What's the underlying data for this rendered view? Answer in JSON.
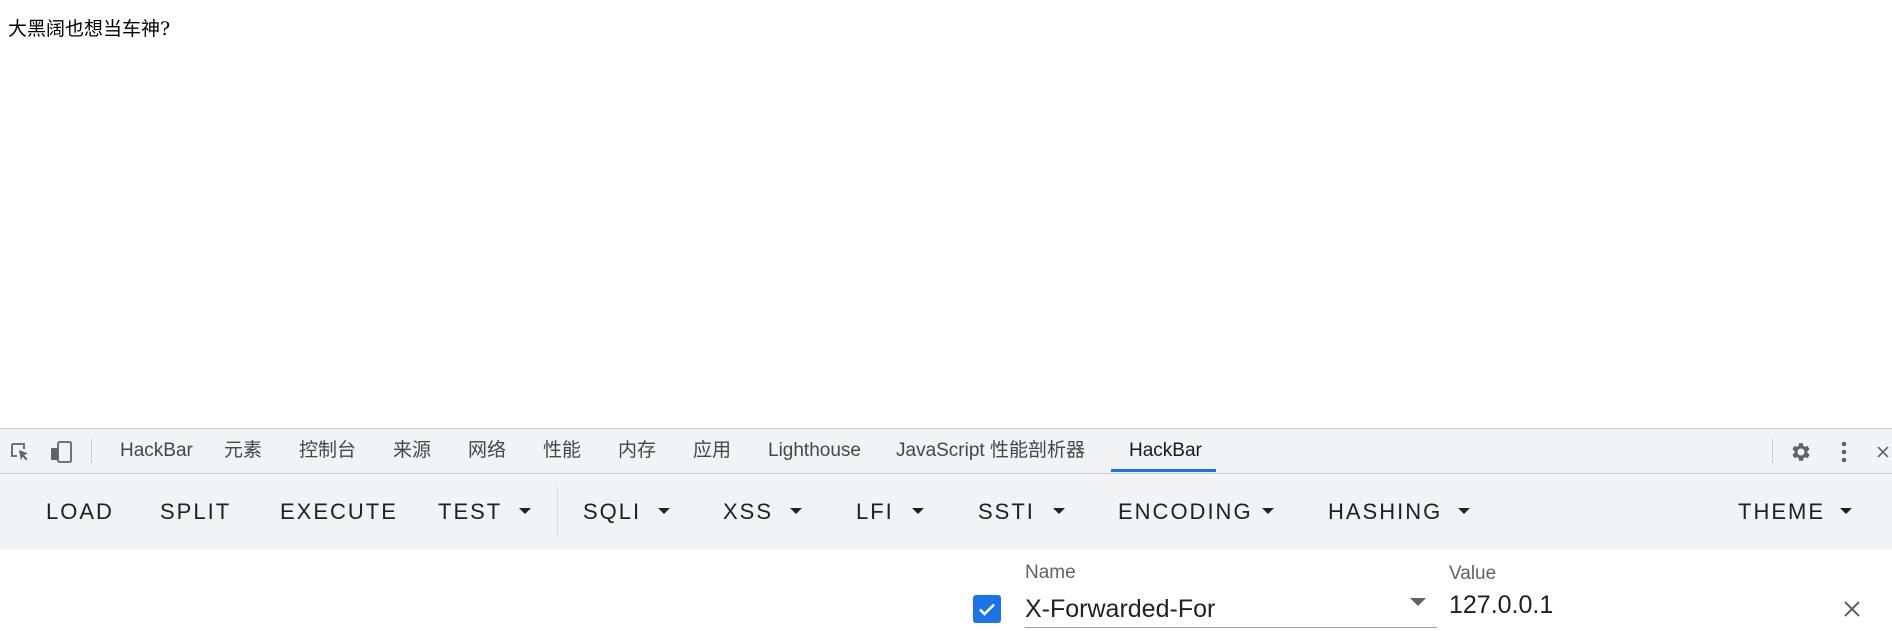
{
  "page": {
    "body_text": "大黑阔也想当车神?"
  },
  "devtools": {
    "tabs": [
      {
        "label": "HackBar"
      },
      {
        "label": "元素"
      },
      {
        "label": "控制台"
      },
      {
        "label": "来源"
      },
      {
        "label": "网络"
      },
      {
        "label": "性能"
      },
      {
        "label": "内存"
      },
      {
        "label": "应用"
      },
      {
        "label": "Lighthouse"
      },
      {
        "label": "JavaScript 性能剖析器"
      },
      {
        "label": "HackBar",
        "active": true
      }
    ],
    "icons": [
      "inspect-element-icon",
      "device-toggle-icon",
      "gear-icon",
      "more-vertical-icon",
      "close-icon"
    ],
    "accent_color": "#1a73e8"
  },
  "hackbar": {
    "buttons": [
      {
        "label": "LOAD",
        "dropdown": false
      },
      {
        "label": "SPLIT",
        "dropdown": false
      },
      {
        "label": "EXECUTE",
        "dropdown": false
      },
      {
        "label": "TEST",
        "dropdown": true
      },
      {
        "label": "SQLI",
        "dropdown": true
      },
      {
        "label": "XSS",
        "dropdown": true
      },
      {
        "label": "LFI",
        "dropdown": true
      },
      {
        "label": "SSTI",
        "dropdown": true
      },
      {
        "label": "ENCODING",
        "dropdown": true
      },
      {
        "label": "HASHING",
        "dropdown": true
      },
      {
        "label": "THEME",
        "dropdown": true
      }
    ],
    "header_row": {
      "enabled": true,
      "name_label": "Name",
      "name_value": "X-Forwarded-For",
      "value_label": "Value",
      "value_value": "127.0.0.1"
    }
  }
}
